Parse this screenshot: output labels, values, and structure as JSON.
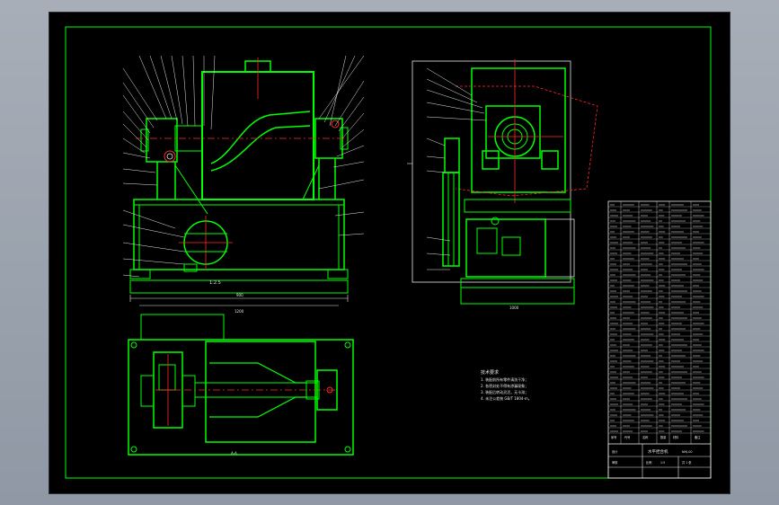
{
  "view_labels": {
    "side_view_label": "1:2.5",
    "top_view_label": "A-A"
  },
  "dimensions": {
    "side_inner_width": "900",
    "side_overall_width": "1200",
    "end_view_width": "1000"
  },
  "technical_requirements": [
    "技术要求",
    "1. 装配前所有零件清洗干净；",
    "2. 各密封处不得有渗漏现象；",
    "3. 装配后转动灵活，无卡滞；",
    "4. 未注公差按 GB/T 1804-m。"
  ],
  "title_block": {
    "drawing_title": "水平捏合机",
    "drawing_number": "NHJ-00",
    "scale_label": "比例",
    "scale_value": "1:5",
    "sheet_label": "共 1 张",
    "designer_label": "设计",
    "checker_label": "审核"
  },
  "parts_list_header": [
    "序号",
    "代号",
    "名称",
    "数量",
    "材料",
    "备注"
  ],
  "colors": {
    "linework": "#00ff00",
    "text": "#e8e8e8",
    "centerline": "#ff2a2a",
    "background": "#000000",
    "viewport": "#9aa2ad"
  }
}
